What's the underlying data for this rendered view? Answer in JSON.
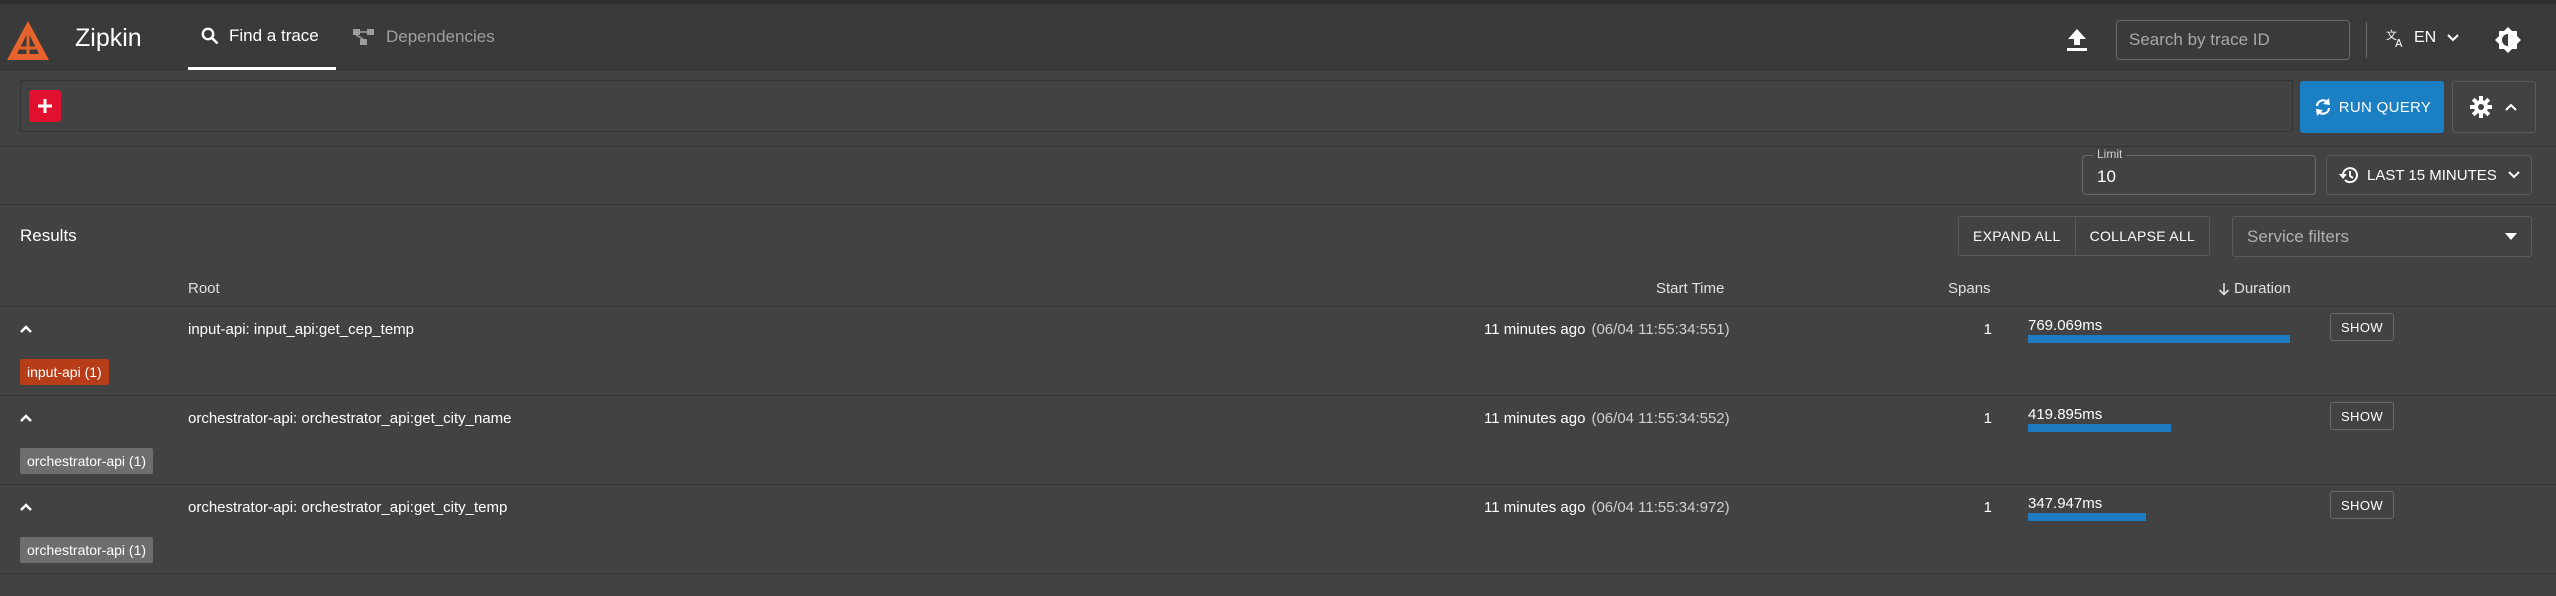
{
  "header": {
    "app_name": "Zipkin",
    "tabs": [
      {
        "label": "Find a trace",
        "icon": "search-icon",
        "active": true
      },
      {
        "label": "Dependencies",
        "icon": "dependencies-icon",
        "active": false
      }
    ],
    "search_placeholder": "Search by trace ID",
    "language": "EN"
  },
  "query": {
    "run_label": "RUN QUERY",
    "limit_label": "Limit",
    "limit_value": "10",
    "time_range_label": "LAST 15 MINUTES"
  },
  "results": {
    "title": "Results",
    "expand_all": "EXPAND ALL",
    "collapse_all": "COLLAPSE ALL",
    "service_filter_placeholder": "Service filters",
    "columns": {
      "root": "Root",
      "start_time": "Start Time",
      "spans": "Spans",
      "duration": "Duration"
    },
    "rows": [
      {
        "root": "input-api: input_api:get_cep_temp",
        "relative_time": "11 minutes ago",
        "absolute_time": "(06/04 11:55:34:551)",
        "spans": "1",
        "duration": "769.069ms",
        "duration_fraction": 1.0,
        "show_label": "SHOW",
        "badge": "input-api (1)",
        "badge_color": "#b73d19"
      },
      {
        "root": "orchestrator-api: orchestrator_api:get_city_name",
        "relative_time": "11 minutes ago",
        "absolute_time": "(06/04 11:55:34:552)",
        "spans": "1",
        "duration": "419.895ms",
        "duration_fraction": 0.546,
        "show_label": "SHOW",
        "badge": "orchestrator-api (1)",
        "badge_color": "#6e6e6e"
      },
      {
        "root": "orchestrator-api: orchestrator_api:get_city_temp",
        "relative_time": "11 minutes ago",
        "absolute_time": "(06/04 11:55:34:972)",
        "spans": "1",
        "duration": "347.947ms",
        "duration_fraction": 0.452,
        "show_label": "SHOW",
        "badge": "orchestrator-api (1)",
        "badge_color": "#6e6e6e"
      }
    ]
  },
  "colors": {
    "accent": "#1b7fc4",
    "add_button": "#e0102e",
    "logo": "#e8622c"
  }
}
